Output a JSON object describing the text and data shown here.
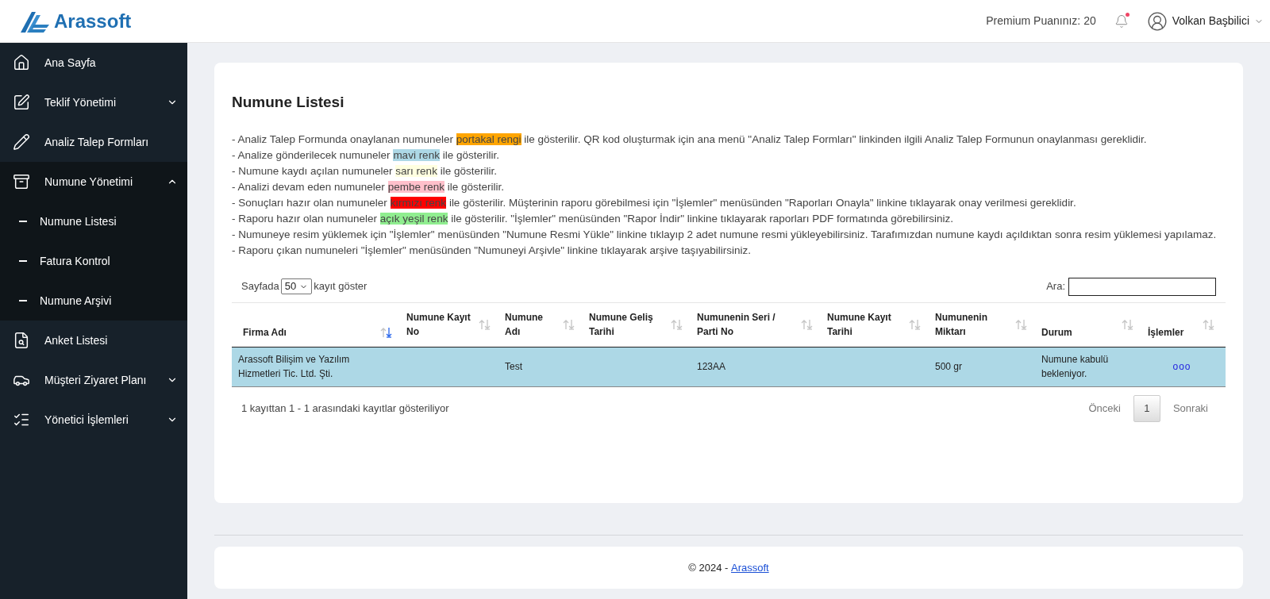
{
  "header": {
    "logo": "Arassoft",
    "premium": "Premium Puanınız: 20",
    "notification_dot": true,
    "user": "Volkan Başbilici"
  },
  "sidebar": {
    "items": [
      {
        "label": "Ana Sayfa"
      },
      {
        "label": "Teklif Yönetimi",
        "expanded": false
      },
      {
        "label": "Analiz Talep Formları"
      },
      {
        "label": "Numune Yönetimi",
        "expanded": true,
        "children": [
          {
            "label": "Numune Listesi"
          },
          {
            "label": "Fatura Kontrol"
          },
          {
            "label": "Numune Arşivi"
          }
        ]
      },
      {
        "label": "Anket Listesi"
      },
      {
        "label": "Müşteri Ziyaret Planı",
        "expanded": false
      },
      {
        "label": "Yönetici İşlemleri",
        "expanded": false
      }
    ]
  },
  "page": {
    "title": "Numune Listesi",
    "notes": [
      {
        "before": "- Analiz Talep Formunda onaylanan numuneler ",
        "highlight": "portakal rengi",
        "color": "#ffa500",
        "after": " ile gösterilir. QR kod oluşturmak için ana menü \"Analiz Talep Formları\" linkinden ilgili Analiz Talep Formunun onaylanması gereklidir."
      },
      {
        "before": "- Analize gönderilecek numuneler ",
        "highlight": "mavi renk",
        "color": "#add8e6",
        "after": " ile gösterilir."
      },
      {
        "before": "- Numune kaydı açılan numuneler ",
        "highlight": "sarı renk",
        "color": "#ffffe0",
        "after": " ile gösterilir."
      },
      {
        "before": "- Analizi devam eden numuneler ",
        "highlight": "pembe renk",
        "color": "#ffc0cb",
        "after": " ile gösterilir."
      },
      {
        "before": "- Sonuçları hazır olan numuneler ",
        "highlight": "kırmızı renk",
        "color": "#ff0000",
        "after": " ile gösterilir. Müşterinin raporu görebilmesi için \"İşlemler\" menüsünden \"Raporları Onayla\" linkine tıklayarak onay verilmesi gereklidir."
      },
      {
        "before": "- Raporu hazır olan numuneler ",
        "highlight": "açık yeşil renk",
        "color": "#90ee90",
        "after": " ile gösterilir. \"İşlemler\" menüsünden \"Rapor İndir\" linkine tıklayarak raporları PDF formatında görebilirsiniz."
      },
      {
        "before": "- Numuneye resim yüklemek için \"İşlemler\" menüsünden \"Numune Resmi Yükle\" linkine tıklayıp 2 adet numune resmi yükleyebilirsiniz. Tarafımızdan numune kaydı açıldıktan sonra resim yüklemesi yapılamaz."
      },
      {
        "before": "- Raporu çıkan numuneleri \"İşlemler\" menüsünden \"Numuneyi Arşivle\" linkine tıklayarak arşive taşıyabilirsiniz."
      }
    ],
    "length": {
      "before": "Sayfada",
      "value": "50",
      "after": "kayıt göster"
    },
    "search": {
      "label": "Ara:"
    },
    "table": {
      "columns": [
        {
          "label": "Firma Adı",
          "sorted": true
        },
        {
          "label": "Numune Kayıt No",
          "sorted": false
        },
        {
          "label": "Numune Adı",
          "sorted": false
        },
        {
          "label": "Numune Geliş Tarihi",
          "sorted": false
        },
        {
          "label": "Numunenin Seri / Parti No",
          "sorted": false
        },
        {
          "label": "Numune Kayıt Tarihi",
          "sorted": false
        },
        {
          "label": "Numunenin Miktarı",
          "sorted": false
        },
        {
          "label": "Durum",
          "sorted": false
        },
        {
          "label": "İşlemler",
          "sorted": false
        }
      ],
      "rows": [
        {
          "color": "#add8e6",
          "cells": [
            "Arassoft Bilişim ve Yazılım Hizmetleri Tic. Ltd. Şti.",
            "",
            "Test",
            "",
            "123AA",
            "",
            "500 gr",
            "Numune kabulü bekleniyor.",
            "ooo"
          ]
        }
      ]
    },
    "info": "1 kayıttan 1 - 1 arasındaki kayıtlar gösteriliyor",
    "pagination": {
      "prev": "Önceki",
      "pages": [
        {
          "label": "1",
          "selected": true
        }
      ],
      "next": "Sonraki"
    }
  },
  "footer": {
    "text": "© 2024 - ",
    "link": "Arassoft"
  }
}
